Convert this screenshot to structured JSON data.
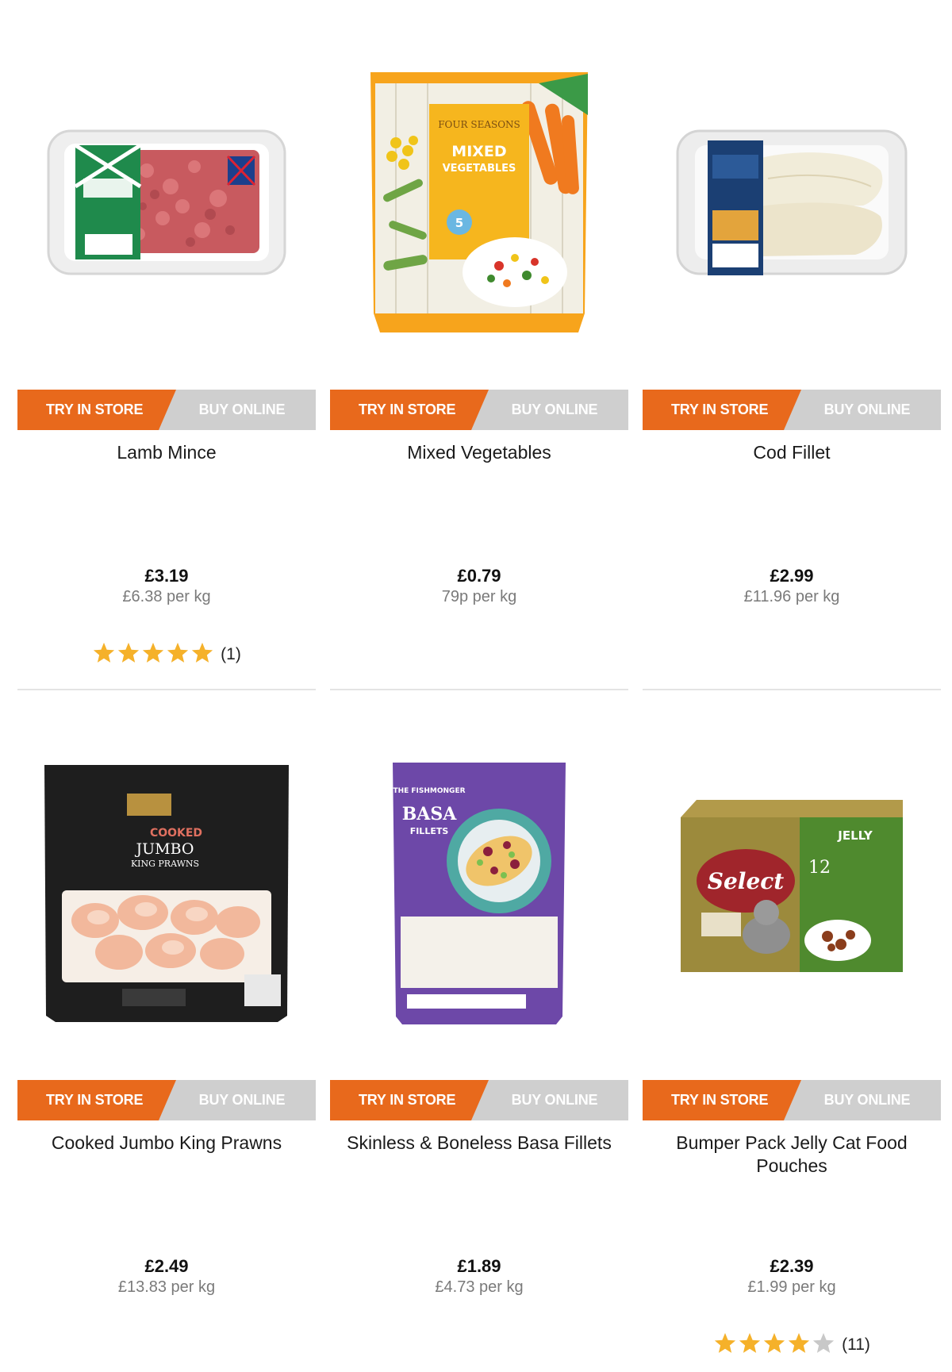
{
  "colors": {
    "try_in_store": "#e8691c",
    "buy_online": "#cfcfcf",
    "star_filled": "#f5b12a",
    "star_empty": "#c8c8c8"
  },
  "products": [
    {
      "name": "Lamb Mince",
      "price": "£3.19",
      "unit_price": "£6.38 per kg",
      "try_label": "TRY IN STORE",
      "buy_label": "BUY ONLINE",
      "image_icon": "lamb-mince-pack-image",
      "rating": 5,
      "rating_count": "(1)"
    },
    {
      "name": "Mixed Vegetables",
      "price": "£0.79",
      "unit_price": "79p per kg",
      "try_label": "TRY IN STORE",
      "buy_label": "BUY ONLINE",
      "image_icon": "mixed-vegetables-bag-image",
      "image_text": {
        "brand": "FOUR SEASONS",
        "title": "MIXED",
        "subtitle": "VEGETABLES",
        "badge": "5"
      }
    },
    {
      "name": "Cod Fillet",
      "price": "£2.99",
      "unit_price": "£11.96 per kg",
      "try_label": "TRY IN STORE",
      "buy_label": "BUY ONLINE",
      "image_icon": "cod-fillet-tray-image"
    },
    {
      "name": "Cooked Jumbo King Prawns",
      "price": "£2.49",
      "unit_price": "£13.83 per kg",
      "try_label": "TRY IN STORE",
      "buy_label": "BUY ONLINE",
      "image_icon": "king-prawns-pack-image",
      "image_text": {
        "title": "COOKED",
        "subtitle": "JUMBO",
        "line3": "KING PRAWNS"
      }
    },
    {
      "name": "Skinless & Boneless Basa Fillets",
      "price": "£1.89",
      "unit_price": "£4.73 per kg",
      "try_label": "TRY IN STORE",
      "buy_label": "BUY ONLINE",
      "image_icon": "basa-fillets-pack-image",
      "image_text": {
        "brand": "THE FISHMONGER",
        "title": "BASA",
        "subtitle": "FILLETS"
      }
    },
    {
      "name": "Bumper Pack Jelly Cat Food Pouches",
      "price": "£2.39",
      "unit_price": "£1.99 per kg",
      "try_label": "TRY IN STORE",
      "buy_label": "BUY ONLINE",
      "image_icon": "cat-food-box-image",
      "image_text": {
        "brand": "Select",
        "tag": "JELLY",
        "count": "12"
      },
      "rating": 4,
      "rating_count": "(11)"
    }
  ]
}
